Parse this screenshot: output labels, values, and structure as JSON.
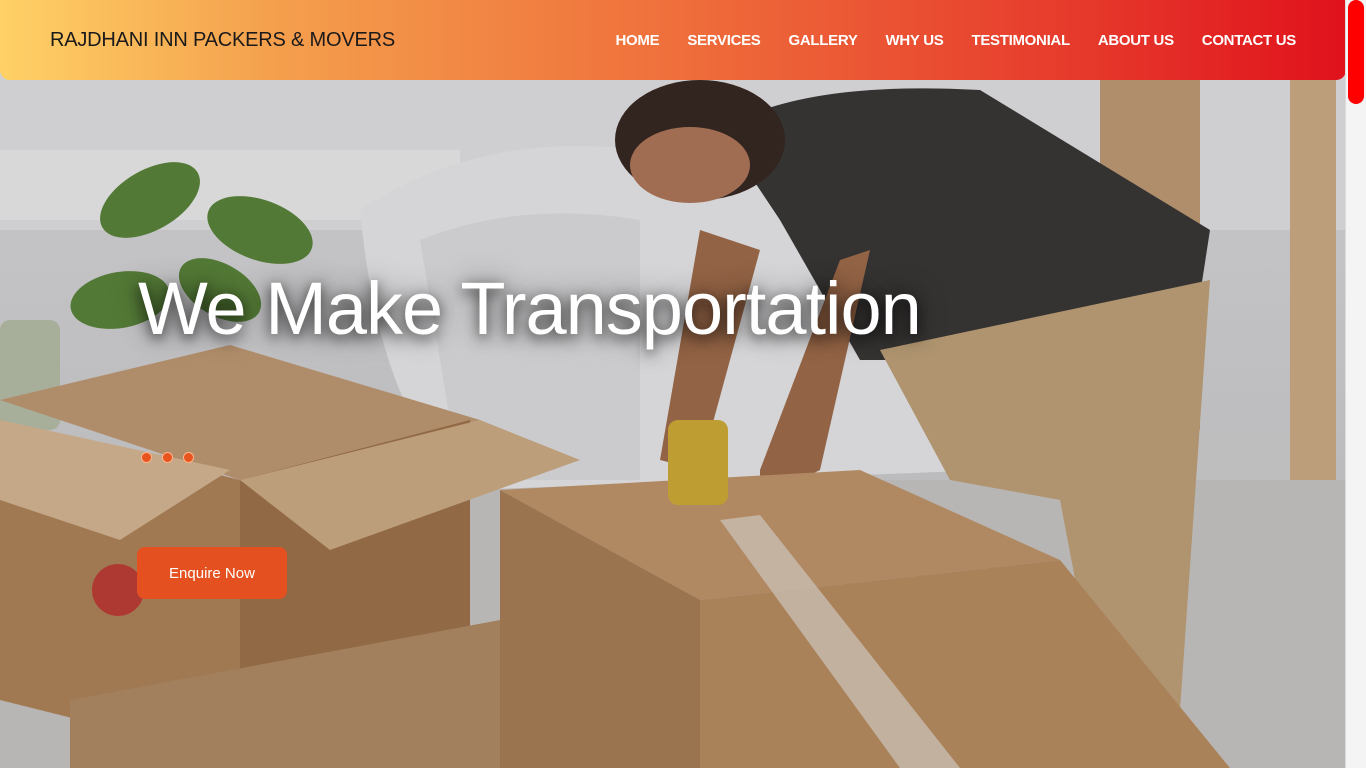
{
  "header": {
    "brand": "RAJDHANI INN PACKERS & MOVERS",
    "nav": [
      "HOME",
      "SERVICES",
      "GALLERY",
      "WHY US",
      "TESTIMONIAL",
      "ABOUT US",
      "CONTACT US"
    ]
  },
  "hero": {
    "headline": "We Make Transportation",
    "cta_label": "Enquire Now",
    "slide_count": 3
  },
  "colors": {
    "accent": "#e55020",
    "header_gradient_start": "#ffd166",
    "header_gradient_end": "#e0121c",
    "scroll_thumb": "#ff0000"
  }
}
